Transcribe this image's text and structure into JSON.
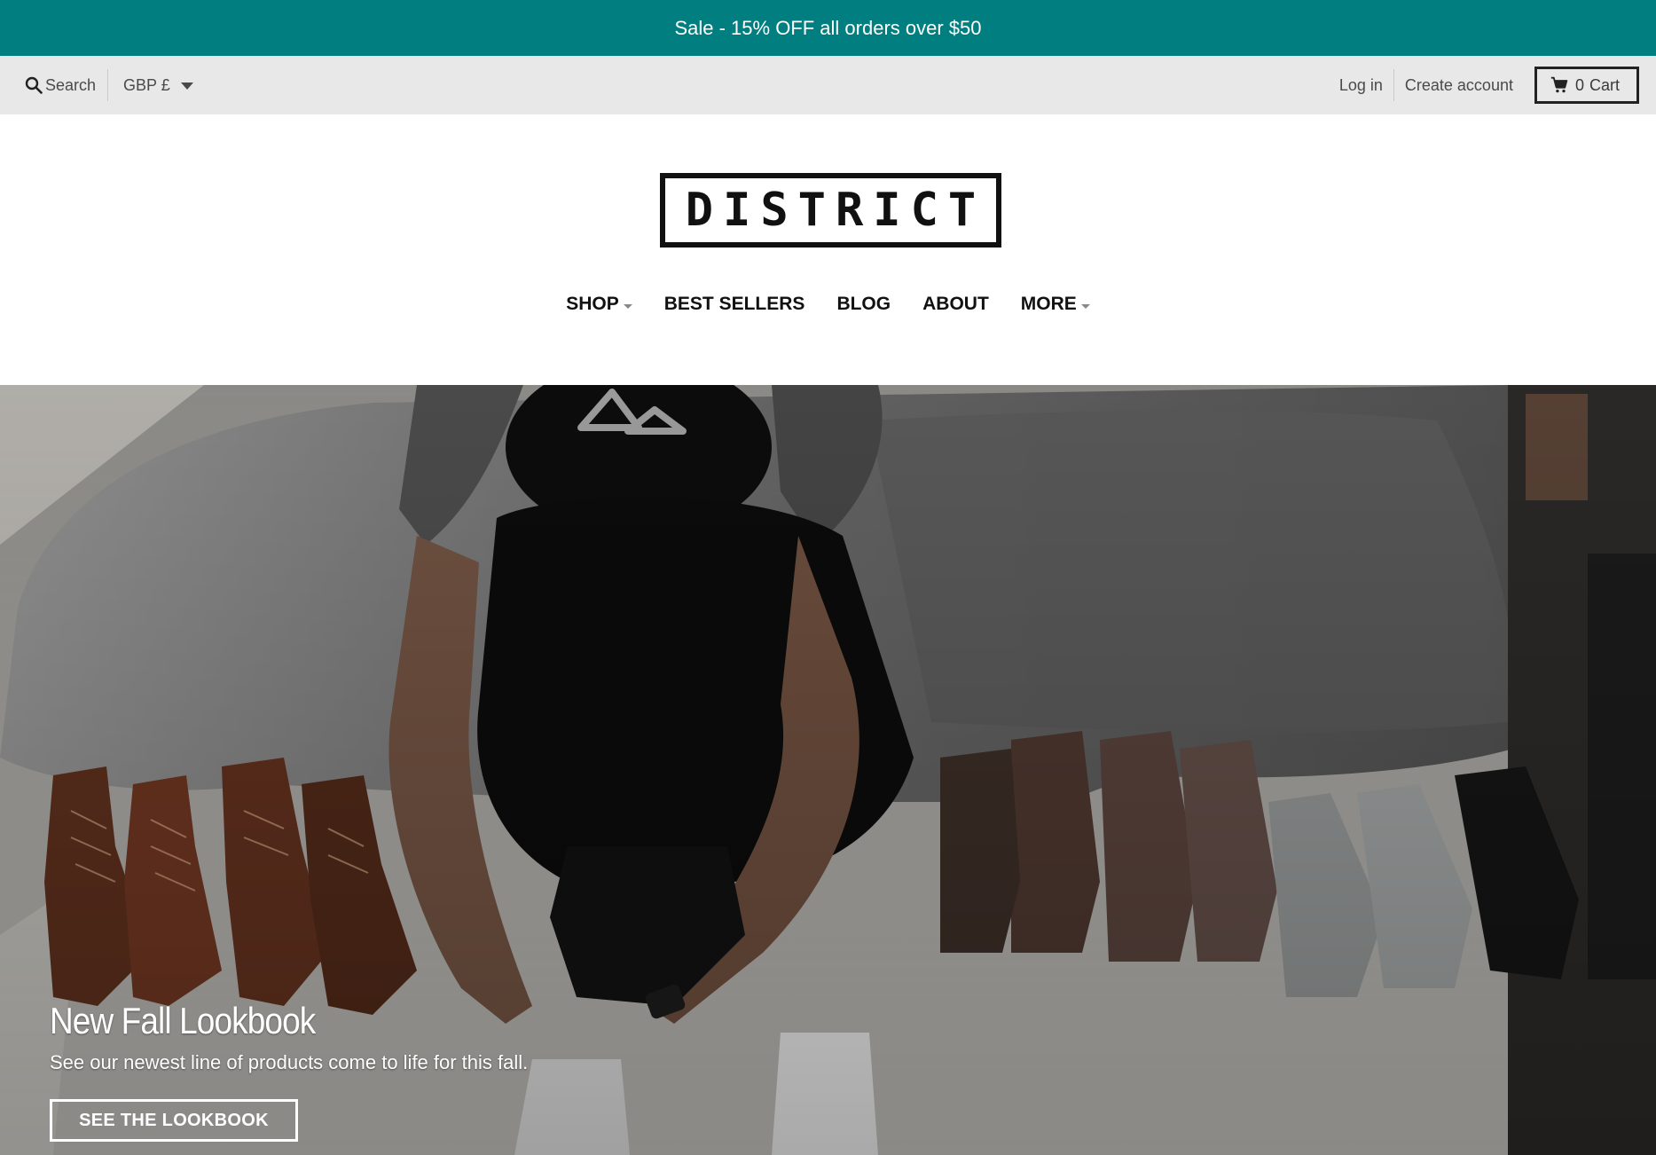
{
  "announcement": {
    "text": "Sale - 15% OFF all orders over $50"
  },
  "utility": {
    "search_label": "Search",
    "currency": "GBP £",
    "login": "Log in",
    "create_account": "Create account",
    "cart_count": "0",
    "cart_label": "Cart"
  },
  "header": {
    "logo": "DISTRICT",
    "nav": [
      {
        "label": "SHOP",
        "has_dropdown": true
      },
      {
        "label": "BEST SELLERS",
        "has_dropdown": false
      },
      {
        "label": "BLOG",
        "has_dropdown": false
      },
      {
        "label": "ABOUT",
        "has_dropdown": false
      },
      {
        "label": "MORE",
        "has_dropdown": true
      }
    ]
  },
  "hero": {
    "title": "New Fall Lookbook",
    "subtitle": "See our newest line of products come to life for this fall.",
    "button": "SEE THE LOOKBOOK"
  },
  "colors": {
    "announcement_bg": "#017f80",
    "utility_bg": "#e8e8e8",
    "text_dark": "#111111"
  }
}
